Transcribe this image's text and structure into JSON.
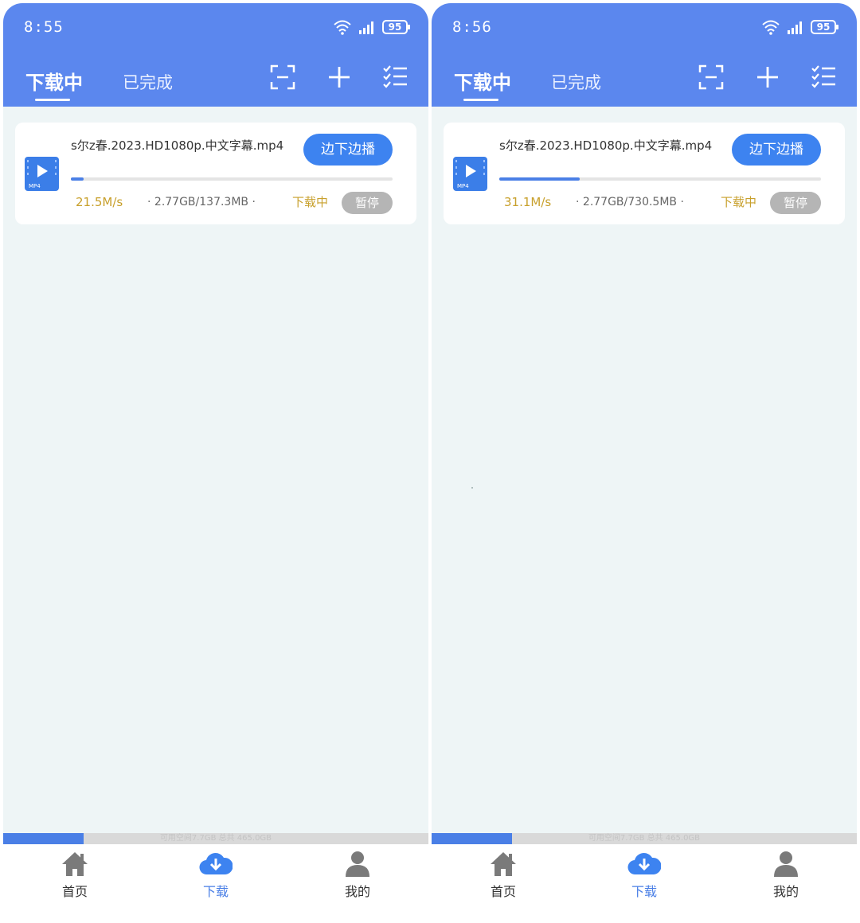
{
  "phones": [
    {
      "status_time": "8:55",
      "battery": "95",
      "tabs": {
        "downloading": "下载中",
        "done": "已完成"
      },
      "task": {
        "file_name": "s尔z春.2023.HD1080p.中文字幕.mp4",
        "file_type": "MP4",
        "stream_label": "边下边播",
        "speed": "21.5M/s",
        "size": "2.77GB/137.3MB",
        "state": "下载中",
        "pause_label": "暂停",
        "progress": 0.04
      },
      "storage": {
        "text": "可用空间7.7GB 总共 465.0GB",
        "used_fraction": 0.19
      },
      "nav": {
        "home": "首页",
        "download": "下载",
        "mine": "我的"
      }
    },
    {
      "status_time": "8:56",
      "battery": "95",
      "tabs": {
        "downloading": "下载中",
        "done": "已完成"
      },
      "task": {
        "file_name": "s尔z春.2023.HD1080p.中文字幕.mp4",
        "file_type": "MP4",
        "stream_label": "边下边播",
        "speed": "31.1M/s",
        "size": "2.77GB/730.5MB",
        "state": "下载中",
        "pause_label": "暂停",
        "progress": 0.25
      },
      "storage": {
        "text": "可用空间7.7GB 总共 465.0GB",
        "used_fraction": 0.19
      },
      "nav": {
        "home": "首页",
        "download": "下载",
        "mine": "我的"
      }
    }
  ],
  "colors": {
    "header": "#5b87ee",
    "accent": "#3d83f0",
    "progress": "#4a7fe6",
    "status_yellow": "#c8a02c",
    "pause_gray": "#b5b5b5",
    "background": "#eef5f6"
  },
  "icons": [
    "wifi-icon",
    "signal-icon",
    "scan-icon",
    "plus-icon",
    "checklist-icon",
    "video-file-icon",
    "home-icon",
    "cloud-download-icon",
    "user-icon"
  ]
}
